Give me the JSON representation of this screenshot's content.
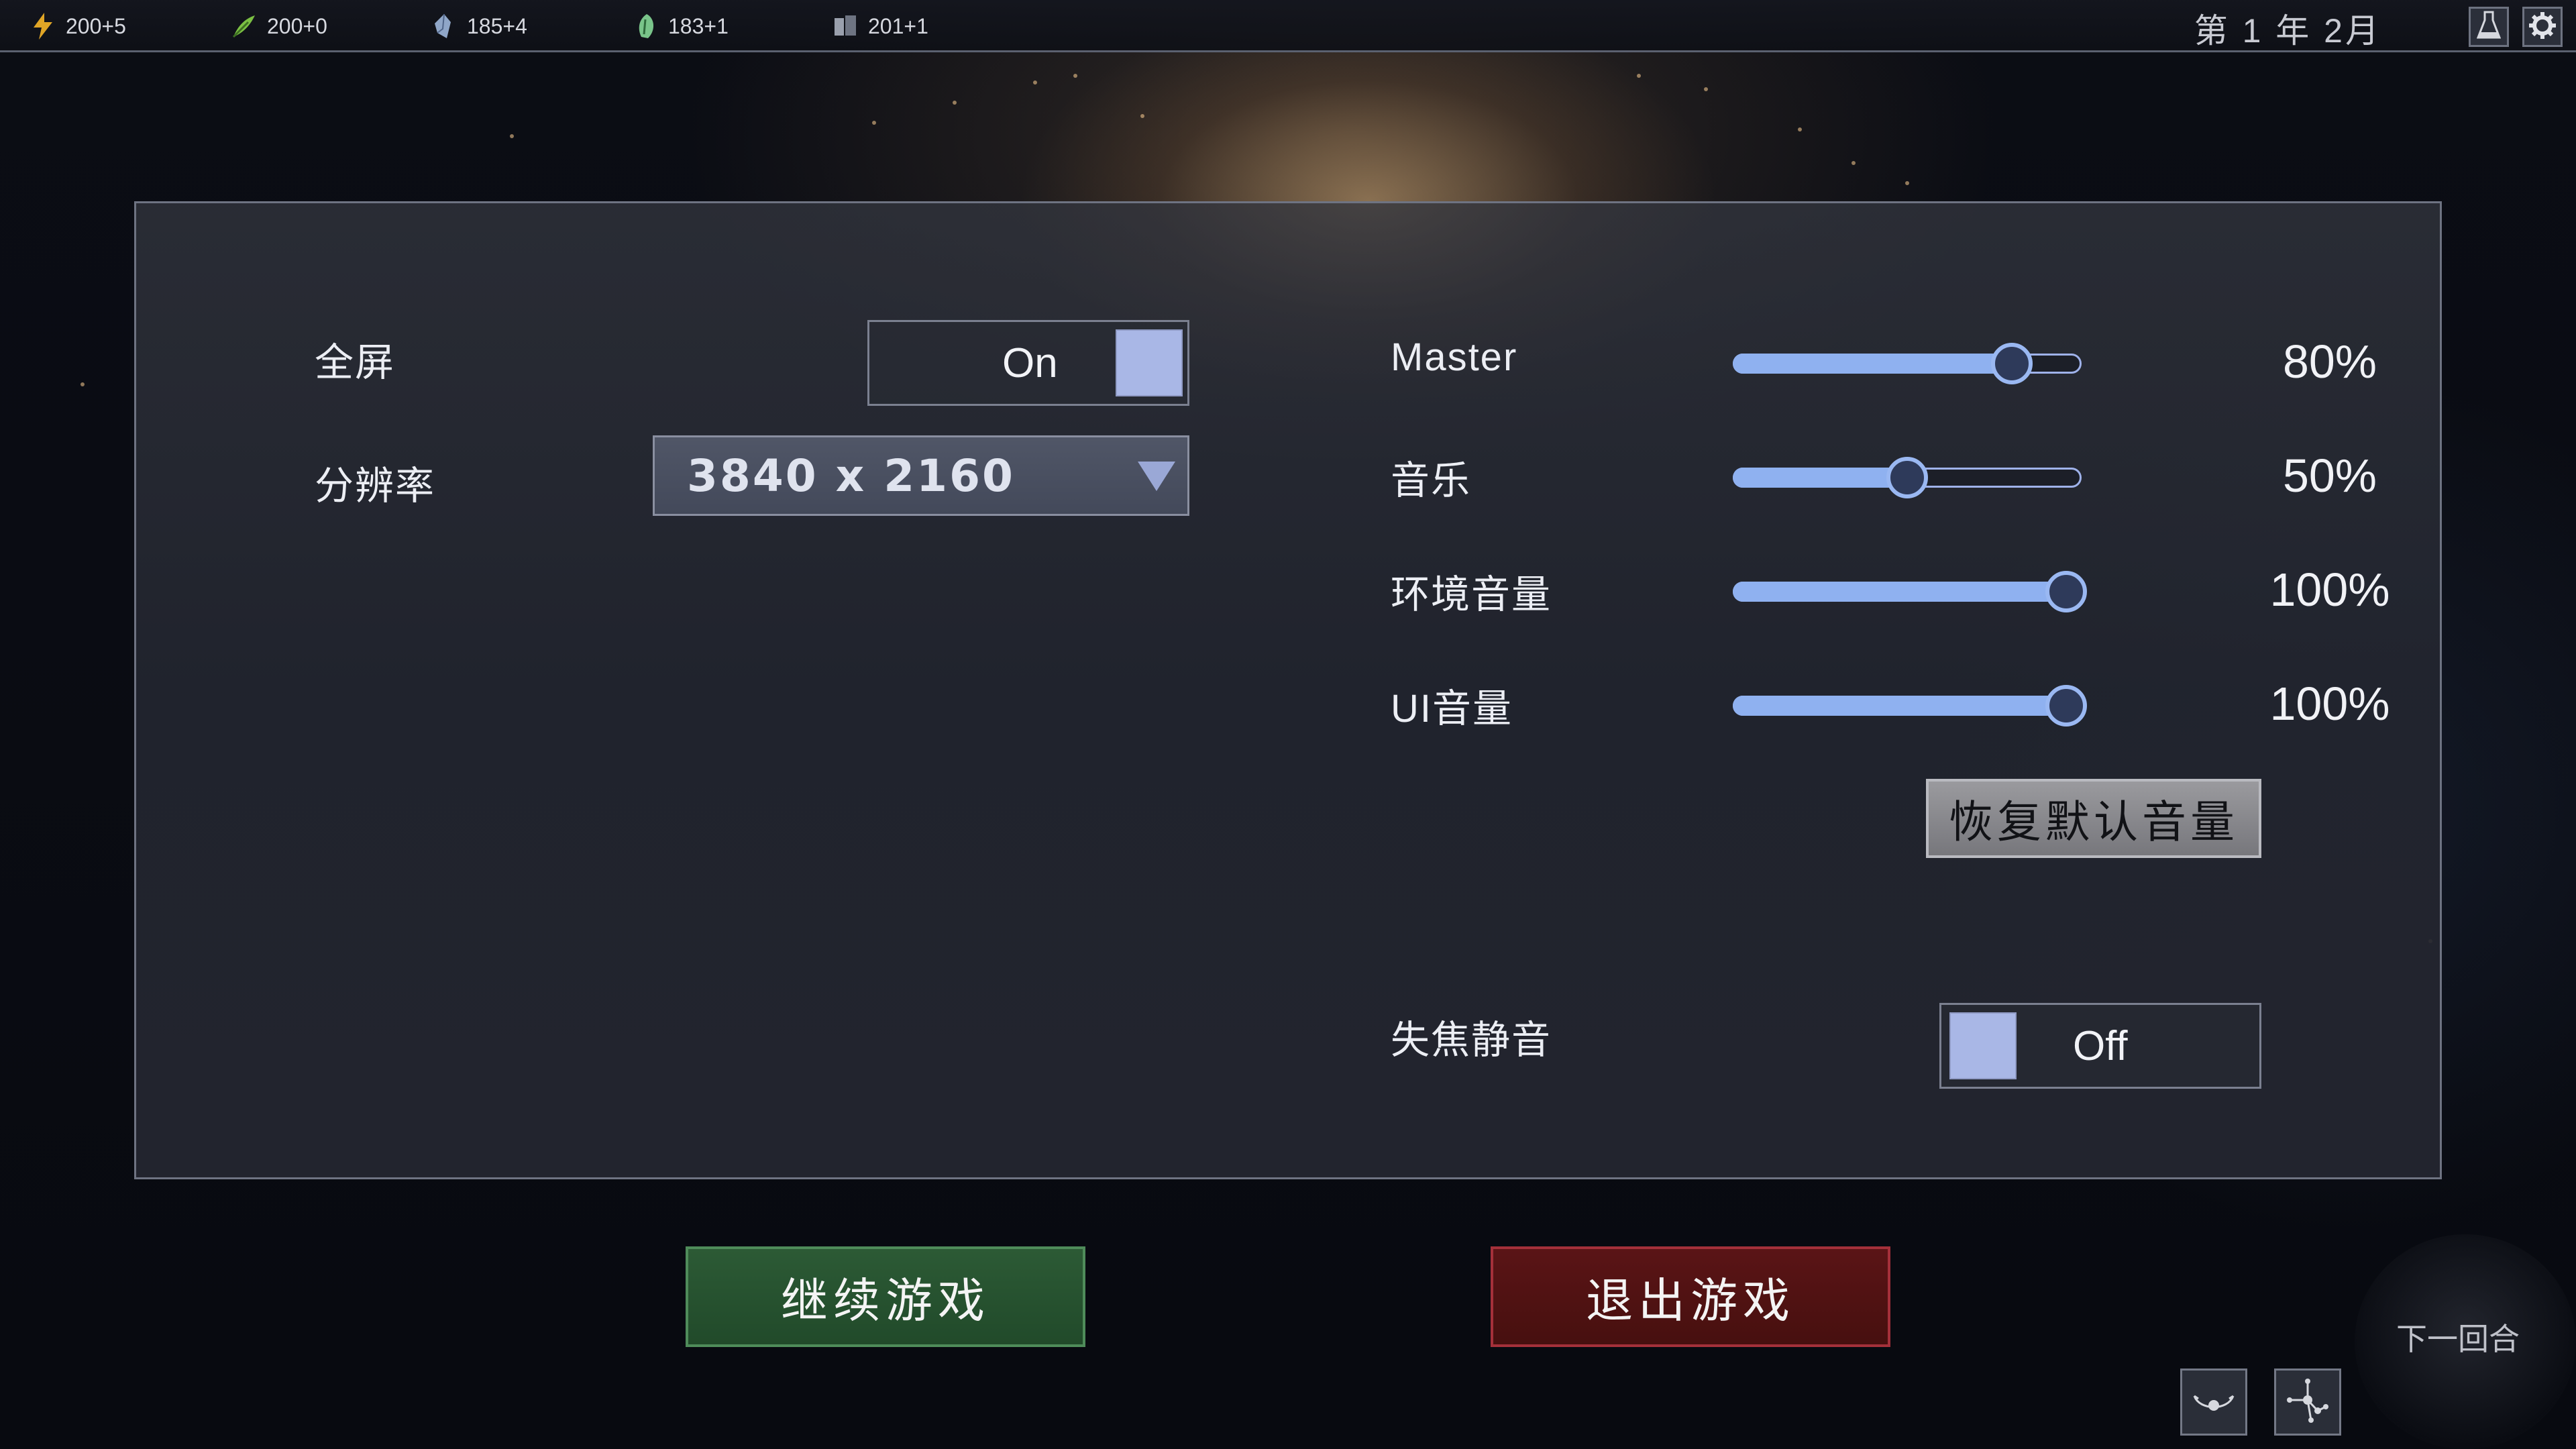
{
  "topbar": {
    "resources": [
      {
        "icon": "energy-icon",
        "value": "200+5",
        "color": "#e0a526"
      },
      {
        "icon": "food-icon",
        "value": "200+0",
        "color": "#7bc043"
      },
      {
        "icon": "minerals-icon",
        "value": "185+4",
        "color": "#8fa6c8"
      },
      {
        "icon": "science-icon",
        "value": "183+1",
        "color": "#79c48a"
      },
      {
        "icon": "alloys-icon",
        "value": "201+1",
        "color": "#9aa0ad"
      }
    ],
    "date": "第 1 年  2月",
    "icons": [
      "research-flask-icon",
      "settings-gear-icon"
    ]
  },
  "settings": {
    "fullscreen": {
      "label": "全屏",
      "state": "On"
    },
    "resolution": {
      "label": "分辨率",
      "value": "3840 x 2160"
    },
    "volumes": [
      {
        "label": "Master",
        "value": "80%",
        "level": 0.8
      },
      {
        "label": "音乐",
        "value": "50%",
        "level": 0.5
      },
      {
        "label": "环境音量",
        "value": "100%",
        "level": 1.0
      },
      {
        "label": "UI音量",
        "value": "100%",
        "level": 1.0
      }
    ],
    "reset_label": "恢复默认音量",
    "mute_unfocused": {
      "label": "失焦静音",
      "state": "Off"
    }
  },
  "actions": {
    "continue_label": "继续游戏",
    "exit_label": "退出游戏",
    "next_turn_label": "下一回合"
  },
  "colors": {
    "accent": "#a9b7e6",
    "slider_fill": "#8fb1f0",
    "continue": "#2c5a35",
    "exit": "#5a1416"
  }
}
